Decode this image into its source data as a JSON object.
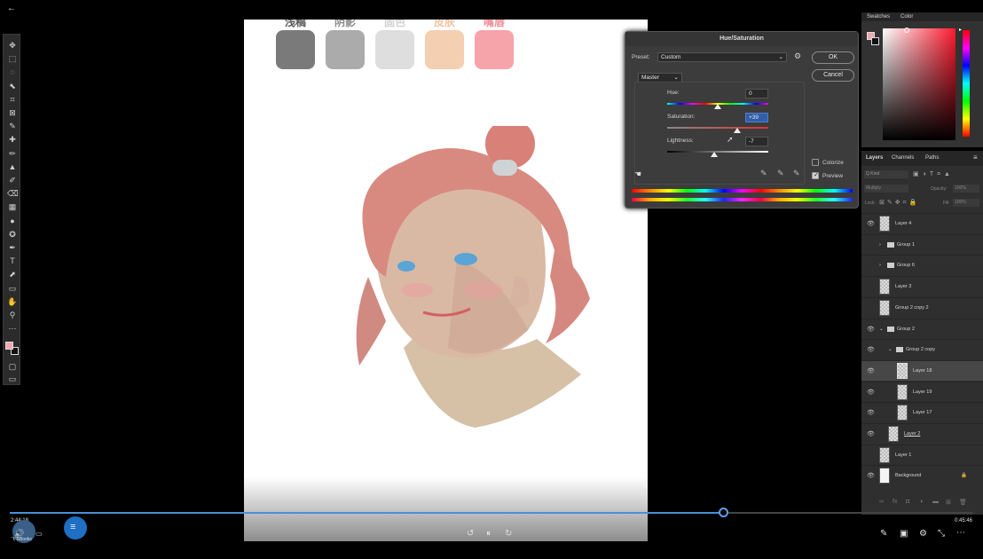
{
  "topbar": {
    "back_icon": "←"
  },
  "toolbar": {
    "tools": [
      "move-icon",
      "marquee-icon",
      "lasso-icon",
      "quick-select-icon",
      "crop-icon",
      "frame-icon",
      "eyedropper-icon",
      "healing-icon",
      "brush-icon",
      "stamp-icon",
      "history-brush-icon",
      "eraser-icon",
      "gradient-icon",
      "blur-icon",
      "dodge-icon",
      "pen-icon",
      "type-icon",
      "path-select-icon",
      "rectangle-icon",
      "hand-icon",
      "zoom-icon",
      "more-icon"
    ],
    "glyphs": [
      "✥",
      "⬚",
      "◌",
      "⬉",
      "⌗",
      "⊠",
      "✎",
      "✚",
      "✏",
      "▲",
      "✐",
      "⌫",
      "▦",
      "●",
      "✪",
      "✒",
      "T",
      "⬈",
      "▭",
      "✋",
      "⚲",
      "⋯"
    ],
    "fg_color": "#f4a6ae",
    "bg_color": "#111111"
  },
  "canvas": {
    "swatch_labels": [
      "浅稿",
      "阴影",
      "固色",
      "皮肤",
      "嘴唇"
    ],
    "swatch_colors": [
      "#7a7a7a",
      "#ababab",
      "#dedede",
      "#f4cfb1",
      "#f6a3aa"
    ],
    "label_colors": [
      "#5a5a5a",
      "#8a8a8a",
      "#cfcfcf",
      "#f0c2a0",
      "#f08c95"
    ]
  },
  "hue_saturation": {
    "title": "Hue/Saturation",
    "preset_label": "Preset:",
    "preset_value": "Custom",
    "ok_label": "OK",
    "cancel_label": "Cancel",
    "channel_value": "Master",
    "hue_label": "Hue:",
    "hue_value": "0",
    "saturation_label": "Saturation:",
    "saturation_value": "+39",
    "lightness_label": "Lightness:",
    "lightness_value": "-7",
    "colorize_label": "Colorize",
    "colorize_checked": false,
    "preview_label": "Preview",
    "preview_checked": true
  },
  "color_panel": {
    "tabs": [
      "Swatches",
      "Color"
    ],
    "fg_color": "#f4a6ae",
    "hue_color": "#ff1a2e"
  },
  "layers_panel": {
    "tabs": [
      "Layers",
      "Channels",
      "Paths"
    ],
    "kind_label": "Q Kind",
    "blend_mode": "Multiply",
    "opacity_label": "Opacity:",
    "opacity_value": "100%",
    "lock_label": "Lock:",
    "fill_label": "Fill:",
    "fill_value": "100%",
    "layers": [
      {
        "name": "Layer 4",
        "type": "layer",
        "visible": true,
        "indent": 0
      },
      {
        "name": "Group 1",
        "type": "group",
        "visible": false,
        "indent": 0
      },
      {
        "name": "Group 6",
        "type": "group",
        "visible": false,
        "indent": 0
      },
      {
        "name": "Layer 3",
        "type": "layer",
        "visible": false,
        "indent": 0
      },
      {
        "name": "Group 2 copy 2",
        "type": "layer",
        "visible": false,
        "indent": 0
      },
      {
        "name": "Group 2",
        "type": "group-open",
        "visible": true,
        "indent": 0
      },
      {
        "name": "Group 2 copy",
        "type": "group-open",
        "visible": true,
        "indent": 1
      },
      {
        "name": "Layer 18",
        "type": "layer",
        "visible": true,
        "indent": 2,
        "selected": true
      },
      {
        "name": "Layer 19",
        "type": "layer",
        "visible": true,
        "indent": 2
      },
      {
        "name": "Layer 17",
        "type": "layer",
        "visible": true,
        "indent": 2
      },
      {
        "name": "Layer 2",
        "type": "layer",
        "visible": true,
        "indent": 1,
        "underlined": true
      },
      {
        "name": "Layer 1",
        "type": "layer",
        "visible": false,
        "indent": 0
      },
      {
        "name": "Background",
        "type": "background",
        "visible": true,
        "indent": 0
      }
    ],
    "footer_icons": [
      "link-icon",
      "fx-icon",
      "mask-icon",
      "adjustment-icon",
      "folder-icon",
      "new-layer-icon",
      "trash-icon"
    ],
    "footer_glyphs": [
      "∞",
      "fx",
      "◘",
      "◑",
      "▬",
      "⊞",
      "🗑"
    ]
  },
  "video": {
    "current_time": "2:44:18",
    "total_time": "0:45:46",
    "progress": 0.74,
    "captions_label": "飞书Books",
    "rewind_icon": "↺",
    "pause_icon": "⏸",
    "forward_icon": "↻"
  }
}
